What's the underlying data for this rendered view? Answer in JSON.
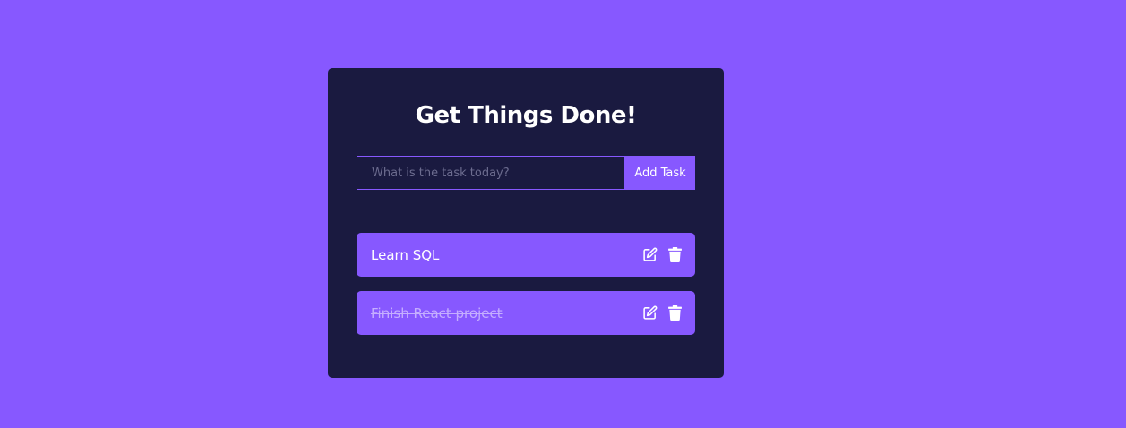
{
  "app": {
    "title": "Get Things Done!"
  },
  "form": {
    "input_value": "",
    "input_placeholder": "What is the task today?",
    "submit_label": "Add Task"
  },
  "todos": [
    {
      "text": "Learn SQL",
      "completed": false,
      "edit_icon": "edit-icon",
      "delete_icon": "trash-icon"
    },
    {
      "text": "Finish React project",
      "completed": true,
      "edit_icon": "edit-icon",
      "delete_icon": "trash-icon"
    }
  ],
  "colors": {
    "background": "#8758ff",
    "card": "#1a1a40",
    "accent": "#8758ff",
    "text": "#ffffff",
    "completed_text": "#c5aeff"
  }
}
